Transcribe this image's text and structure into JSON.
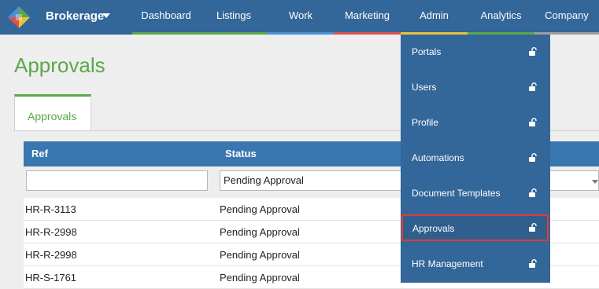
{
  "brand": {
    "label": "Brokerage",
    "logo": "brokerage-logo"
  },
  "nav": [
    {
      "label": "Dashboard",
      "stripe": "#5ba84a"
    },
    {
      "label": "Listings",
      "stripe": "#5ba84a"
    },
    {
      "label": "Work",
      "stripe": "#4a90d9"
    },
    {
      "label": "Marketing",
      "stripe": "#d9534f"
    },
    {
      "label": "Admin",
      "stripe": "#e8c43a"
    },
    {
      "label": "Analytics",
      "stripe": "#5ba84a"
    },
    {
      "label": "Company",
      "stripe": "#9e9e9e"
    }
  ],
  "page": {
    "title": "Approvals",
    "tab": "Approvals"
  },
  "table": {
    "headers": {
      "ref": "Ref",
      "status": "Status"
    },
    "filter": {
      "ref": "",
      "status": "Pending Approval"
    },
    "rows": [
      {
        "ref": "HR-R-3113",
        "status": "Pending Approval"
      },
      {
        "ref": "HR-R-2998",
        "status": "Pending Approval"
      },
      {
        "ref": "HR-R-2998",
        "status": "Pending Approval"
      },
      {
        "ref": "HR-S-1761",
        "status": "Pending Approval"
      }
    ]
  },
  "admin_menu": [
    {
      "label": "Portals",
      "icon": "unlock-icon"
    },
    {
      "label": "Users",
      "icon": "unlock-icon"
    },
    {
      "label": "Profile",
      "icon": "unlock-icon"
    },
    {
      "label": "Automations",
      "icon": "unlock-icon"
    },
    {
      "label": "Document Templates",
      "icon": "unlock-icon"
    },
    {
      "label": "Approvals",
      "icon": "unlock-icon",
      "selected": true
    },
    {
      "label": "HR Management",
      "icon": "unlock-icon"
    }
  ],
  "colors": {
    "navbar": "#336699",
    "accent_green": "#5ba84a",
    "table_header": "#3a77b1",
    "highlight_border": "#e03c31"
  }
}
